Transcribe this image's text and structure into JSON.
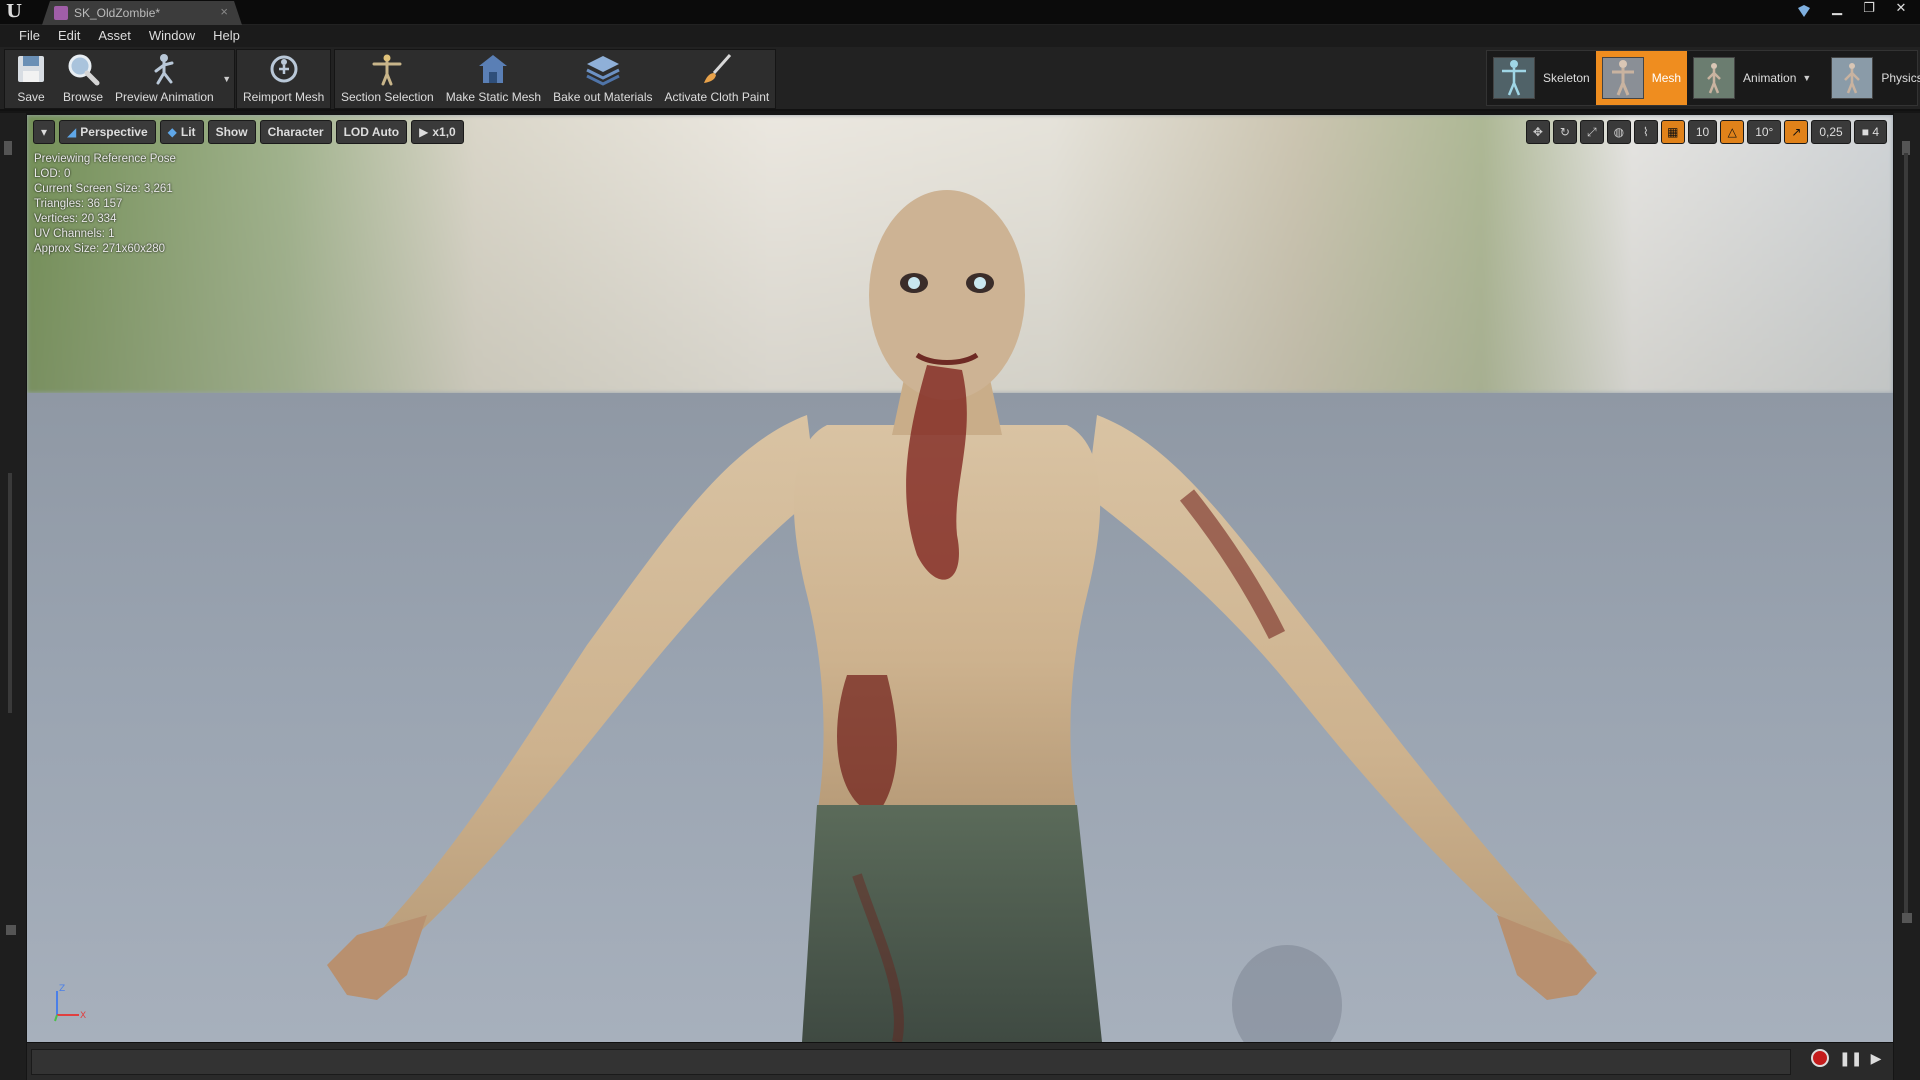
{
  "titlebar": {
    "tab_label": "SK_OldZombie*",
    "close": "×",
    "win_min": "▁",
    "win_max": "❐",
    "win_close": "✕"
  },
  "menu": [
    "File",
    "Edit",
    "Asset",
    "Window",
    "Help"
  ],
  "toolbar": {
    "save": "Save",
    "browse": "Browse",
    "preview_animation": "Preview Animation",
    "reimport_mesh": "Reimport Mesh",
    "section_selection": "Section Selection",
    "make_static_mesh": "Make Static Mesh",
    "bake_out_materials": "Bake out Materials",
    "activate_cloth_paint": "Activate Cloth Paint"
  },
  "modes": {
    "skeleton": "Skeleton",
    "mesh": "Mesh",
    "animation": "Animation",
    "physics": "Physics",
    "active": "Mesh"
  },
  "viewport_bar": {
    "perspective": "Perspective",
    "lit": "Lit",
    "show": "Show",
    "character": "Character",
    "lod": "LOD Auto",
    "speed": "x1,0"
  },
  "viewport_tools": {
    "grid_snap": "10",
    "rot_snap": "10°",
    "scale_snap": "0,25",
    "cam_speed": "4"
  },
  "info": [
    "Previewing Reference Pose",
    "LOD: 0",
    "Current Screen Size: 3,261",
    "Triangles: 36 157",
    "Vertices: 20 334",
    "UV Channels: 1",
    "Approx Size: 271x60x280"
  ],
  "axis": {
    "z": "Z",
    "x": "X"
  },
  "colors": {
    "accent": "#ef8d1f",
    "record": "#c41c1c",
    "panel": "#2d2d2d"
  }
}
